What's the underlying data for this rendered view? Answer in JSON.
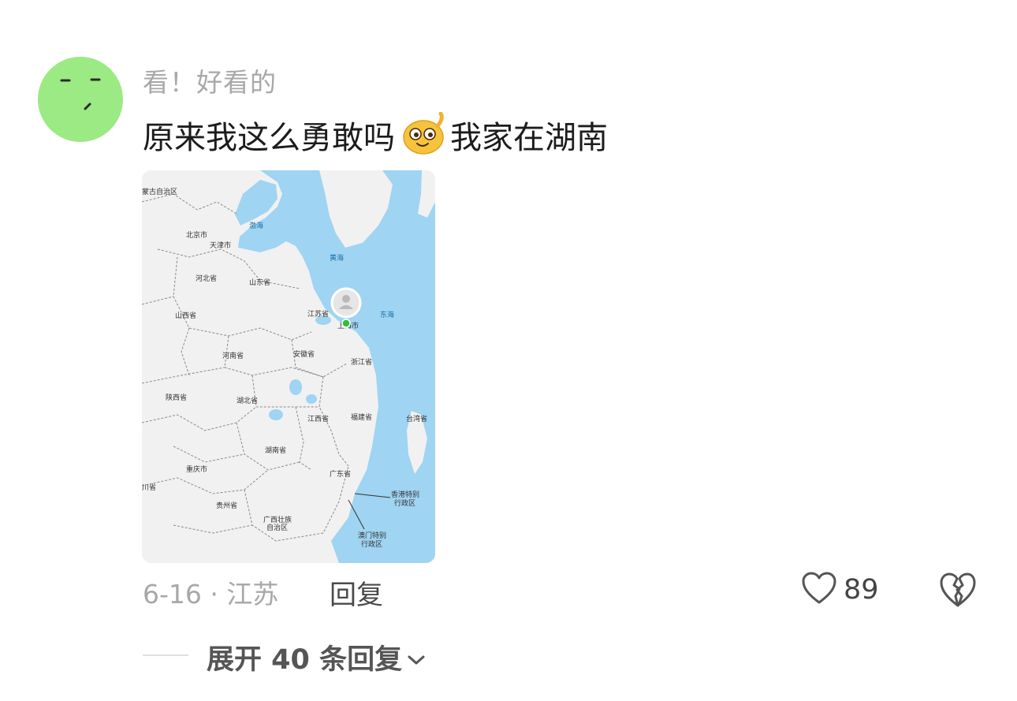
{
  "comment": {
    "username": "看！好看的",
    "text_before": "原来我这么勇敢吗",
    "text_after": "我家在湖南",
    "emoji": "grinning-face-emoji",
    "date_location": "6-16 · 江苏",
    "reply_label": "回复",
    "like_count": "89",
    "expand_label": "展开 40 条回复"
  },
  "map": {
    "labels": {
      "inner_mongolia": "蒙古自治区",
      "beijing": "北京市",
      "tianjin": "天津市",
      "hebei": "河北省",
      "shandong": "山东省",
      "shanxi": "山西省",
      "henan": "河南省",
      "jiangsu": "江苏省",
      "shanghai": "上海市",
      "anhui": "安徽省",
      "zhejiang": "浙江省",
      "shaanxi": "陕西省",
      "hubei": "湖北省",
      "jiangxi": "江西省",
      "fujian": "福建省",
      "taiwan": "台湾省",
      "hunan": "湖南省",
      "chongqing": "重庆市",
      "sichuan": "川省",
      "guangdong": "广东省",
      "guizhou": "贵州省",
      "guangxi_1": "广西壮族",
      "guangxi_2": "自治区",
      "hongkong_1": "香港特别",
      "hongkong_2": "行政区",
      "macau_1": "澳门特别",
      "macau_2": "行政区",
      "bohai": "渤海",
      "huanghai": "黄海",
      "donghai": "东海"
    },
    "colors": {
      "sea": "#9fd4f2",
      "land": "#f1f1f1",
      "pin": "#2fbf3a"
    }
  },
  "colors": {
    "avatar": "#9bea84",
    "secondary_text": "#a8a8a8",
    "primary_text": "#1c1c1c"
  }
}
